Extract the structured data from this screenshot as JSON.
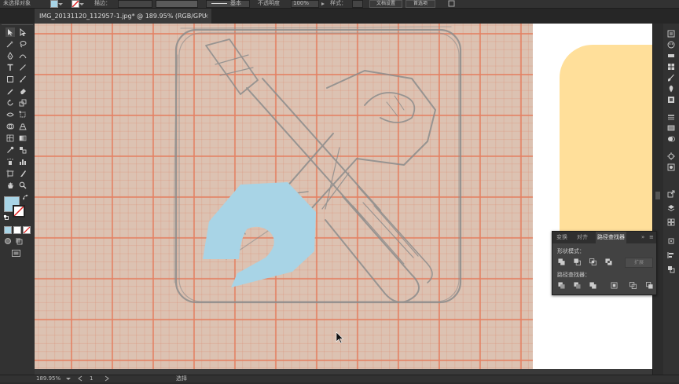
{
  "control_bar": {
    "selection_label": "未选择对象",
    "stroke_label": "描边：",
    "basic_label": "基本",
    "opacity_label": "不透明度",
    "opacity_value": "100%",
    "style_label": "样式：",
    "doc_setup_label": "文档设置",
    "prefs_label": "首选项",
    "fill_color": "#a8d4e6"
  },
  "document": {
    "tab_title": "IMG_20131120_112957-1.jpg* @ 189.95% (RGB/GPU 预览)",
    "close_symbol": "×"
  },
  "artwork": {
    "shape_fill": "#a8d4e6",
    "rounded_panel_color": "#ffdf9a"
  },
  "pathfinder_panel": {
    "tabs": [
      {
        "label": "变换"
      },
      {
        "label": "对齐"
      },
      {
        "label": "路径查找器"
      }
    ],
    "more_symbol": "»",
    "menu_symbol": "≡",
    "shape_modes_label": "形状模式：",
    "pathfinders_label": "路径查找器：",
    "expand_label": "扩展"
  },
  "status_bar": {
    "zoom": "189.95%",
    "artboard": "1",
    "mode": "选择"
  },
  "tools": [
    "selection-tool",
    "direct-selection-tool",
    "magic-wand-tool",
    "lasso-tool",
    "pen-tool",
    "curvature-tool",
    "type-tool",
    "line-tool",
    "rectangle-tool",
    "paintbrush-tool",
    "pencil-tool",
    "eraser-tool",
    "rotate-tool",
    "scale-tool",
    "width-tool",
    "free-transform-tool",
    "shape-builder-tool",
    "perspective-tool",
    "mesh-tool",
    "gradient-tool",
    "eyedropper-tool",
    "blend-tool",
    "symbol-sprayer-tool",
    "column-graph-tool",
    "artboard-tool",
    "slice-tool",
    "hand-tool",
    "zoom-tool"
  ]
}
